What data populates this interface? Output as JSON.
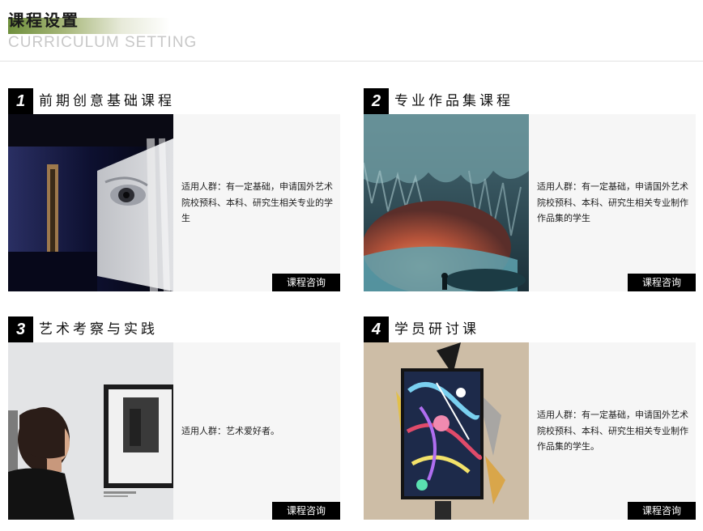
{
  "header": {
    "title_cn": "课程设置",
    "title_en": "CURRICULUM SETTING"
  },
  "colors": {
    "accent_gradient_start": "#6f8f3c",
    "panel_bg": "#f6f6f6",
    "button_bg": "#000000"
  },
  "courses": [
    {
      "number": "1",
      "title": "前期创意基础课程",
      "description": "适用人群：有一定基础，申请国外艺术院校预科、本科、研究生相关专业的学生",
      "button_label": "课程咨询"
    },
    {
      "number": "2",
      "title": "专业作品集课程",
      "description": "适用人群：有一定基础，申请国外艺术院校预科、本科、研究生相关专业制作作品集的学生",
      "button_label": "课程咨询"
    },
    {
      "number": "3",
      "title": "艺术考察与实践",
      "description": "适用人群：艺术爱好者。",
      "button_label": "课程咨询"
    },
    {
      "number": "4",
      "title": "学员研讨课",
      "description": "适用人群：有一定基础，申请国外艺术院校预科、本科、研究生相关专业制作作品集的学生。",
      "button_label": "课程咨询"
    }
  ]
}
